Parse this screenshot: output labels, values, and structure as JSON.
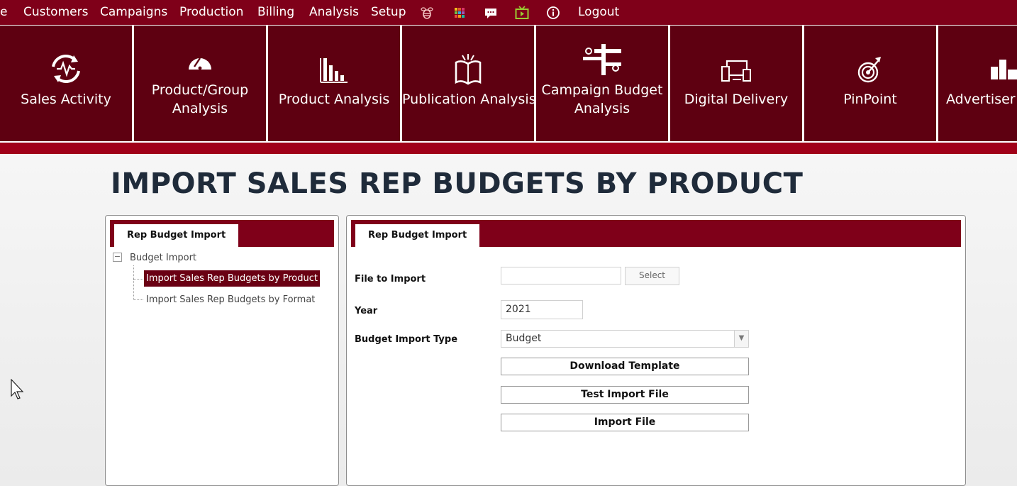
{
  "topnav": {
    "items": [
      "e",
      "Customers",
      "Campaigns",
      "Production",
      "Billing",
      "Analysis",
      "Setup"
    ],
    "icons": [
      "bee-icon",
      "grid-icon",
      "chat-icon",
      "tv-icon",
      "info-icon"
    ],
    "logout": "Logout"
  },
  "tiles": [
    {
      "line1": "Sales Activity",
      "line2": "",
      "icon": "activity-cycle-icon"
    },
    {
      "line1": "Product/Group",
      "line2": "Analysis",
      "icon": "gauge-icon"
    },
    {
      "line1": "Product Analysis",
      "line2": "",
      "icon": "bar-chart-icon"
    },
    {
      "line1": "Publication Analysis",
      "line2": "",
      "icon": "open-book-icon"
    },
    {
      "line1": "Campaign Budget",
      "line2": "Analysis",
      "icon": "plus-minus-icon"
    },
    {
      "line1": "Digital Delivery",
      "line2": "",
      "icon": "devices-icon"
    },
    {
      "line1": "PinPoint",
      "line2": "",
      "icon": "target-icon"
    },
    {
      "line1": "Advertiser R",
      "line2": "",
      "icon": "podium-icon"
    }
  ],
  "page": {
    "title": "IMPORT SALES REP BUDGETS BY PRODUCT"
  },
  "left_panel": {
    "tab": "Rep Budget Import",
    "tree": {
      "root": "Budget Import",
      "children": [
        "Import Sales Rep Budgets by Product",
        "Import Sales Rep Budgets by Format"
      ]
    }
  },
  "right_panel": {
    "tab": "Rep Budget Import",
    "file_label": "File to Import",
    "file_value": "",
    "select_button": "Select",
    "year_label": "Year",
    "year_value": "2021",
    "type_label": "Budget Import Type",
    "type_value": "Budget",
    "download_button": "Download Template",
    "test_button": "Test Import File",
    "import_button": "Import File"
  },
  "colors": {
    "menu_bg": "#7f0019",
    "tile_bg": "#5e0011",
    "band": "#a00018",
    "selected_node": "#6a0013",
    "title": "#1f2b3a"
  }
}
